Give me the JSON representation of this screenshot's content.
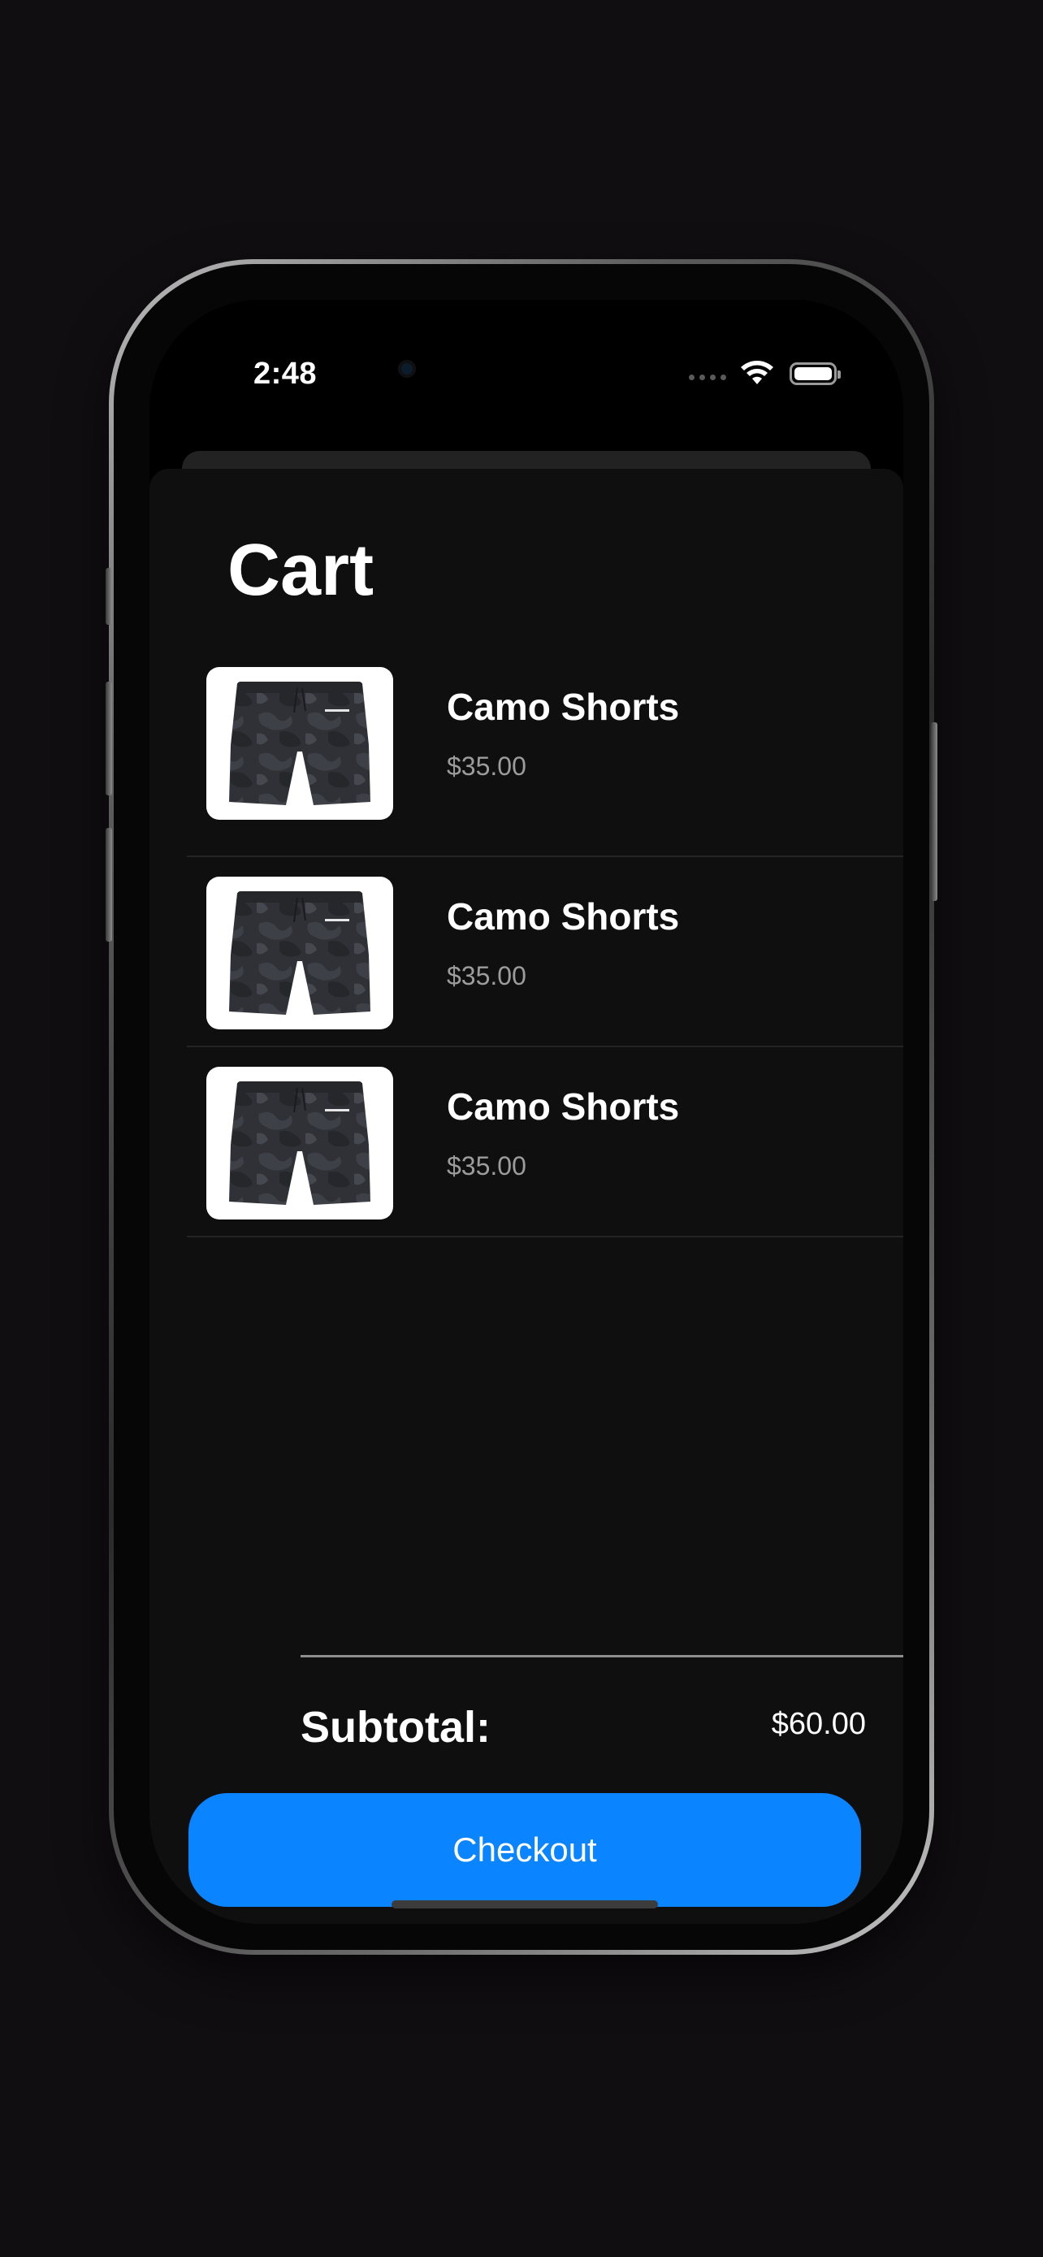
{
  "status_bar": {
    "time": "2:48",
    "icons": [
      "signal-dots-icon",
      "wifi-icon",
      "battery-icon"
    ]
  },
  "page": {
    "title": "Cart"
  },
  "cart": {
    "items": [
      {
        "name": "Camo Shorts",
        "price": "$35.00",
        "image": "camo-shorts-image"
      },
      {
        "name": "Camo Shorts",
        "price": "$35.00",
        "image": "camo-shorts-image"
      },
      {
        "name": "Camo Shorts",
        "price": "$35.00",
        "image": "camo-shorts-image"
      }
    ]
  },
  "summary": {
    "subtotal_label": "Subtotal:",
    "subtotal_value": "$60.00"
  },
  "actions": {
    "checkout_label": "Checkout"
  },
  "colors": {
    "background": "#110e11",
    "sheet": "#0f0f0f",
    "accent": "#0a84ff",
    "secondary_text": "#9c9c9c"
  }
}
